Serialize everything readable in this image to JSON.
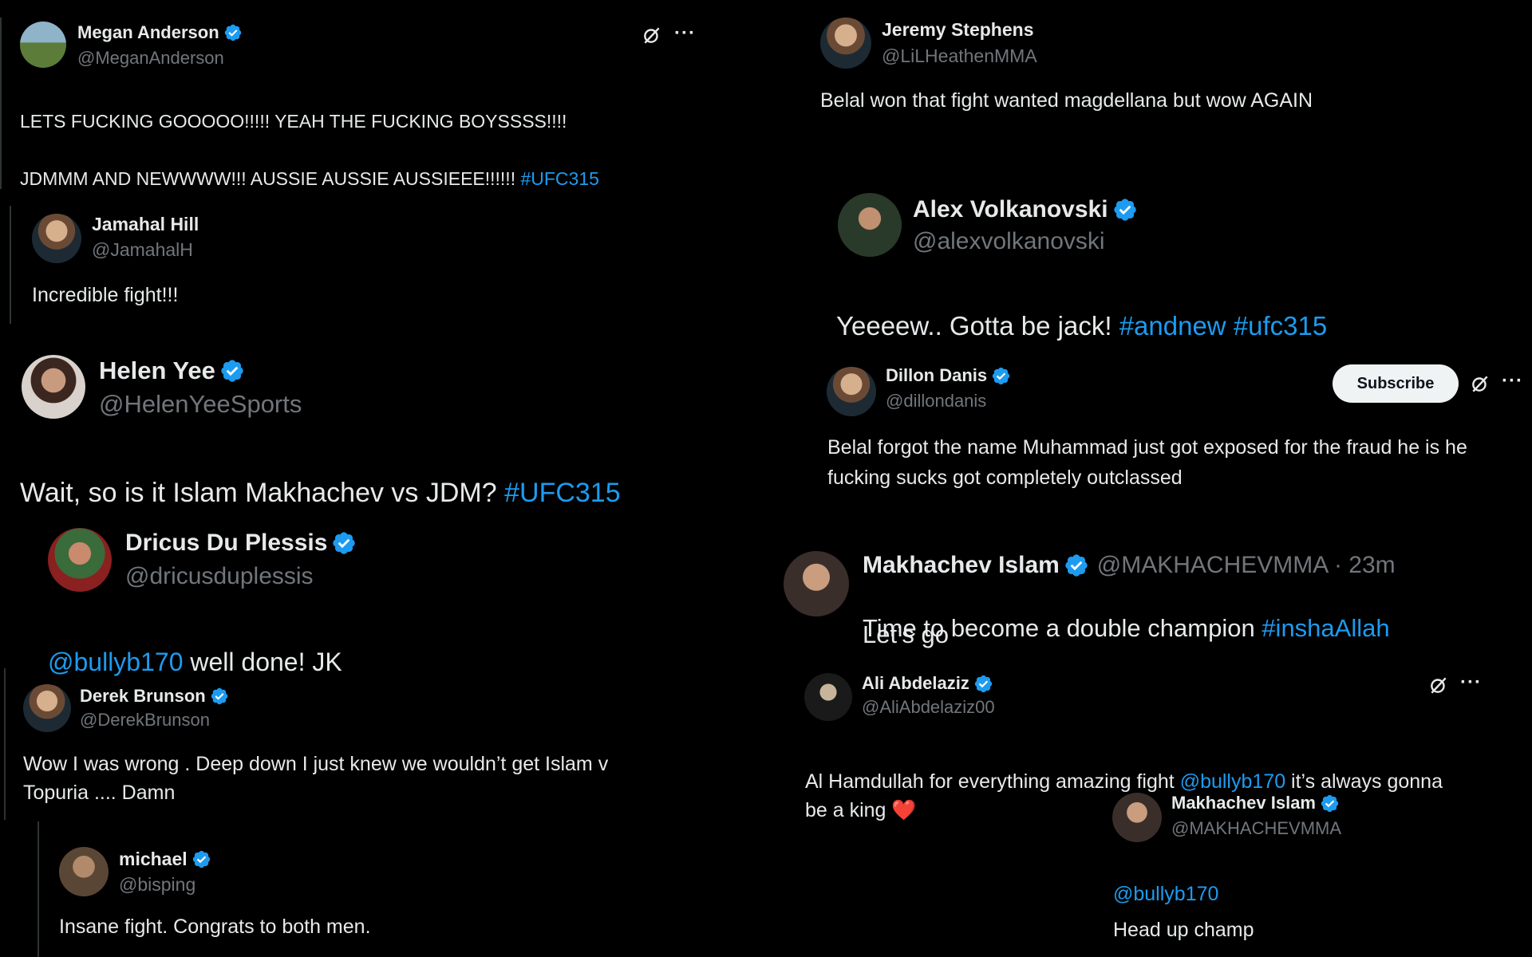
{
  "icons": {
    "verified": "verified-badge-icon",
    "grok": "grok-icon",
    "more": "more-icon",
    "heart": "heart-emoji"
  },
  "colors": {
    "link": "#1d9bf0",
    "verified": "#1d9bf0",
    "muted": "#71767b"
  },
  "tweets": {
    "megan": {
      "name": "Megan Anderson",
      "handle": "@MeganAnderson",
      "line1": "LETS FUCKING GOOOOO!!!!! YEAH THE FUCKING BOYSSSS!!!!",
      "line2": "JDMMM AND NEWWWW!!! AUSSIE AUSSIE AUSSIEEE!!!!!! ",
      "tag": "#UFC315",
      "more": "···"
    },
    "jamahal": {
      "name": "Jamahal Hill",
      "handle": "@JamahalH",
      "text": "Incredible fight!!!"
    },
    "helen": {
      "name": "Helen Yee",
      "handle": "@HelenYeeSports",
      "text": "Wait, so is it Islam Makhachev vs JDM? ",
      "tag": "#UFC315"
    },
    "dricus": {
      "name": "Dricus Du Plessis",
      "handle": "@dricusduplessis",
      "mention": "@bullyb170",
      "text": " well done! JK"
    },
    "derek": {
      "name": "Derek Brunson",
      "handle": "@DerekBrunson",
      "text": "Wow I was wrong . Deep down I just knew we wouldn’t get Islam v\nTopuria .... Damn"
    },
    "michael": {
      "name": "michael",
      "handle": "@bisping",
      "text": "Insane fight. Congrats to both men."
    },
    "jeremy": {
      "name": "Jeremy Stephens",
      "handle": "@LiLHeathenMMA",
      "text": "Belal won that fight wanted magdellana but wow AGAIN"
    },
    "alex": {
      "name": "Alex Volkanovski",
      "handle": "@alexvolkanovski",
      "text": "Yeeeew.. Gotta be jack! ",
      "tag1": "#andnew",
      "tag2": "#ufc315"
    },
    "dillon": {
      "name": "Dillon Danis",
      "handle": "@dillondanis",
      "subscribe": "Subscribe",
      "more": "···",
      "text": "Belal forgot the name Muhammad just got exposed for the fraud he is he\nfucking sucks got completely outclassed"
    },
    "islam1": {
      "name": "Makhachev Islam",
      "meta": "@MAKHACHEVMMA · 23m",
      "text": "Time to become a double champion ",
      "tag": "#inshaAllah",
      "line2": "Let’s go"
    },
    "ali": {
      "name": "Ali Abdelaziz",
      "handle": "@AliAbdelaziz00",
      "more": "···",
      "text1": "Al Hamdullah for everything amazing fight ",
      "mention": "@bullyb170",
      "text2": " it’s always gonna",
      "text3": "be a king ",
      "emoji": "❤️"
    },
    "islam2": {
      "name": "Makhachev Islam",
      "handle": "@MAKHACHEVMMA",
      "mention": "@bullyb170",
      "text": "Head up champ"
    }
  }
}
